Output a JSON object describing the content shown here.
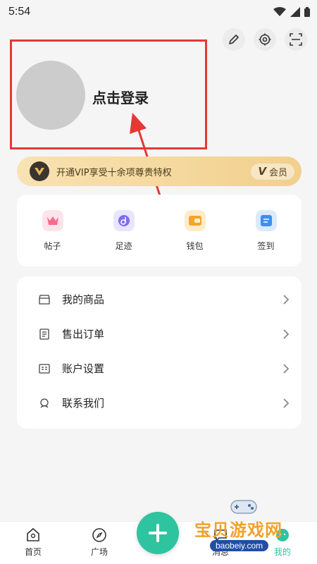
{
  "status_bar": {
    "time": "5:54"
  },
  "top_actions": {
    "edit": "pencil-icon",
    "settings": "gear-icon",
    "scan": "scan-icon"
  },
  "profile": {
    "login_prompt": "点击登录"
  },
  "vip": {
    "promo_text": "开通VIP享受十余项尊贵特权",
    "member_badge_letter": "V",
    "member_badge_label": "会员",
    "color_start": "#f8e2b2",
    "color_end": "#f2d08d"
  },
  "quick_actions": [
    {
      "label": "帖子",
      "icon": "crown-icon",
      "color": "#f56d8c"
    },
    {
      "label": "足迹",
      "icon": "footprint-icon",
      "color": "#7b6cf0"
    },
    {
      "label": "钱包",
      "icon": "wallet-icon",
      "color": "#f5a623"
    },
    {
      "label": "签到",
      "icon": "checkin-icon",
      "color": "#3f8ef0"
    }
  ],
  "menu": [
    {
      "label": "我的商品",
      "icon": "shop-icon"
    },
    {
      "label": "售出订单",
      "icon": "order-icon"
    },
    {
      "label": "账户设置",
      "icon": "account-icon"
    },
    {
      "label": "联系我们",
      "icon": "support-icon"
    }
  ],
  "bottom_nav": {
    "home": "首页",
    "plaza": "广场",
    "message_partial": "消息",
    "mine_partial": "我的"
  },
  "watermark": {
    "title": "宝贝游戏网",
    "url": "baobeiy.com"
  },
  "accent_color": "#2ec4a0"
}
